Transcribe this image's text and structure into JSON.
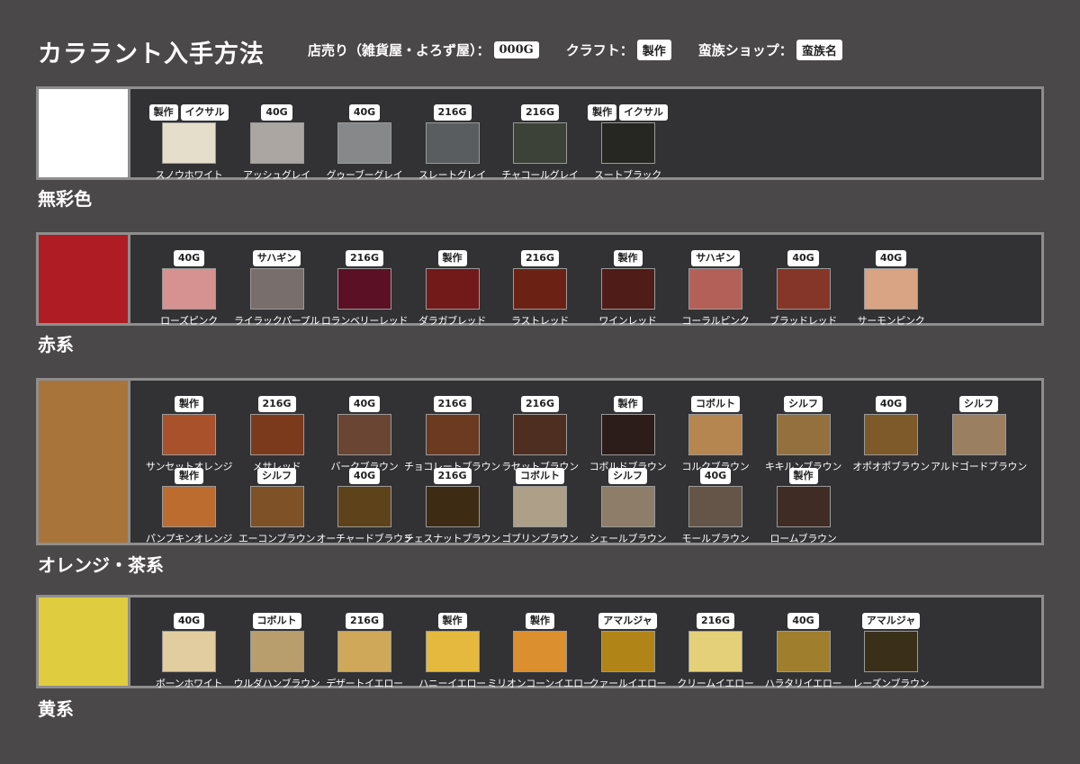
{
  "title": "カララント入手方法",
  "legend": {
    "shop_label": "店売り（雑貨屋・よろず屋）：",
    "shop_badge": "000G",
    "craft_label": "クラフト：",
    "craft_badge": "製作",
    "tribe_label": "蛮族ショップ：",
    "tribe_badge": "蛮族名"
  },
  "sections": [
    {
      "name": "無彩色",
      "color": "#ffffff",
      "rows": [
        [
          {
            "name": "スノウホワイト",
            "color": "#e4decb",
            "badges": [
              "製作",
              "イクサル"
            ]
          },
          {
            "name": "アッシュグレイ",
            "color": "#aba6a2",
            "badges": [
              "40G"
            ]
          },
          {
            "name": "グゥーブーグレイ",
            "color": "#86888a",
            "badges": [
              "40G"
            ]
          },
          {
            "name": "スレートグレイ",
            "color": "#5a5d60",
            "badges": [
              "216G"
            ]
          },
          {
            "name": "チャコールグレイ",
            "color": "#3c4237",
            "badges": [
              "216G"
            ]
          },
          {
            "name": "スートブラック",
            "color": "#262623",
            "badges": [
              "製作",
              "イクサル"
            ]
          }
        ]
      ]
    },
    {
      "name": "赤系",
      "color": "#b01c23",
      "rows": [
        [
          {
            "name": "ローズピンク",
            "color": "#d69191",
            "badges": [
              "40G"
            ]
          },
          {
            "name": "ライラックパープル",
            "color": "#786e6c",
            "badges": [
              "サハギン"
            ]
          },
          {
            "name": "ロランベリーレッド",
            "color": "#5b1025",
            "badges": [
              "216G"
            ]
          },
          {
            "name": "ダラガブレッド",
            "color": "#72191a",
            "badges": [
              "製作"
            ]
          },
          {
            "name": "ラストレッド",
            "color": "#6b2215",
            "badges": [
              "216G"
            ]
          },
          {
            "name": "ワインレッド",
            "color": "#4f1c18",
            "badges": [
              "製作"
            ]
          },
          {
            "name": "コーラルピンク",
            "color": "#b36158",
            "badges": [
              "サハギン"
            ]
          },
          {
            "name": "ブラッドレッド",
            "color": "#863628",
            "badges": [
              "40G"
            ]
          },
          {
            "name": "サーモンピンク",
            "color": "#d9a483",
            "badges": [
              "40G"
            ]
          }
        ]
      ]
    },
    {
      "name": "オレンジ・茶系",
      "color": "#a8743a",
      "rows": [
        [
          {
            "name": "サンセットオレンジ",
            "color": "#a8512b",
            "badges": [
              "製作"
            ]
          },
          {
            "name": "メサレッド",
            "color": "#7c3a1c",
            "badges": [
              "216G"
            ]
          },
          {
            "name": "バークブラウン",
            "color": "#6b4533",
            "badges": [
              "40G"
            ]
          },
          {
            "name": "チョコレートブラウン",
            "color": "#6b3a21",
            "badges": [
              "216G"
            ]
          },
          {
            "name": "ラセットブラウン",
            "color": "#4f2e22",
            "badges": [
              "216G"
            ]
          },
          {
            "name": "コボルドブラウン",
            "color": "#2c1d1a",
            "badges": [
              "製作"
            ]
          },
          {
            "name": "コルクブラウン",
            "color": "#b58650",
            "badges": [
              "コボルト"
            ]
          },
          {
            "name": "キキルンブラウン",
            "color": "#94703f",
            "badges": [
              "シルフ"
            ]
          },
          {
            "name": "オポオポブラウン",
            "color": "#7e5a2a",
            "badges": [
              "40G"
            ]
          },
          {
            "name": "アルドゴードブラウン",
            "color": "#9b7f61",
            "badges": [
              "シルフ"
            ]
          }
        ],
        [
          {
            "name": "パンプキンオレンジ",
            "color": "#bb6c2e",
            "badges": [
              "製作"
            ]
          },
          {
            "name": "エーコンブラウン",
            "color": "#7e5126",
            "badges": [
              "シルフ"
            ]
          },
          {
            "name": "オーチャードブラウン",
            "color": "#5e4219",
            "badges": [
              "40G"
            ]
          },
          {
            "name": "チェスナットブラウン",
            "color": "#3d2b14",
            "badges": [
              "216G"
            ]
          },
          {
            "name": "ゴブリンブラウン",
            "color": "#ad9f88",
            "badges": [
              "コボルト"
            ]
          },
          {
            "name": "シェールブラウン",
            "color": "#8d7d69",
            "badges": [
              "シルフ"
            ]
          },
          {
            "name": "モールブラウン",
            "color": "#655548",
            "badges": [
              "40G"
            ]
          },
          {
            "name": "ロームブラウン",
            "color": "#3f2d25",
            "badges": [
              "製作"
            ]
          }
        ]
      ]
    },
    {
      "name": "黄系",
      "color": "#e0cd3f",
      "rows": [
        [
          {
            "name": "ボーンホワイト",
            "color": "#e1cda0",
            "badges": [
              "40G"
            ]
          },
          {
            "name": "ウルダハンブラウン",
            "color": "#b89e6d",
            "badges": [
              "コボルト"
            ]
          },
          {
            "name": "デザートイエロー",
            "color": "#cfa85a",
            "badges": [
              "216G"
            ]
          },
          {
            "name": "ハニーイエロー",
            "color": "#e4b93e",
            "badges": [
              "製作"
            ]
          },
          {
            "name": "ミリオンコーンイエロー",
            "color": "#dc8f2e",
            "badges": [
              "製作"
            ]
          },
          {
            "name": "クァールイエロー",
            "color": "#b18417",
            "badges": [
              "アマルジャ"
            ]
          },
          {
            "name": "クリームイエロー",
            "color": "#e5d07a",
            "badges": [
              "216G"
            ]
          },
          {
            "name": "ハラタリイエロー",
            "color": "#9f7f2e",
            "badges": [
              "40G"
            ]
          },
          {
            "name": "レーズンブラウン",
            "color": "#3a301a",
            "badges": [
              "アマルジャ"
            ]
          }
        ]
      ]
    }
  ]
}
